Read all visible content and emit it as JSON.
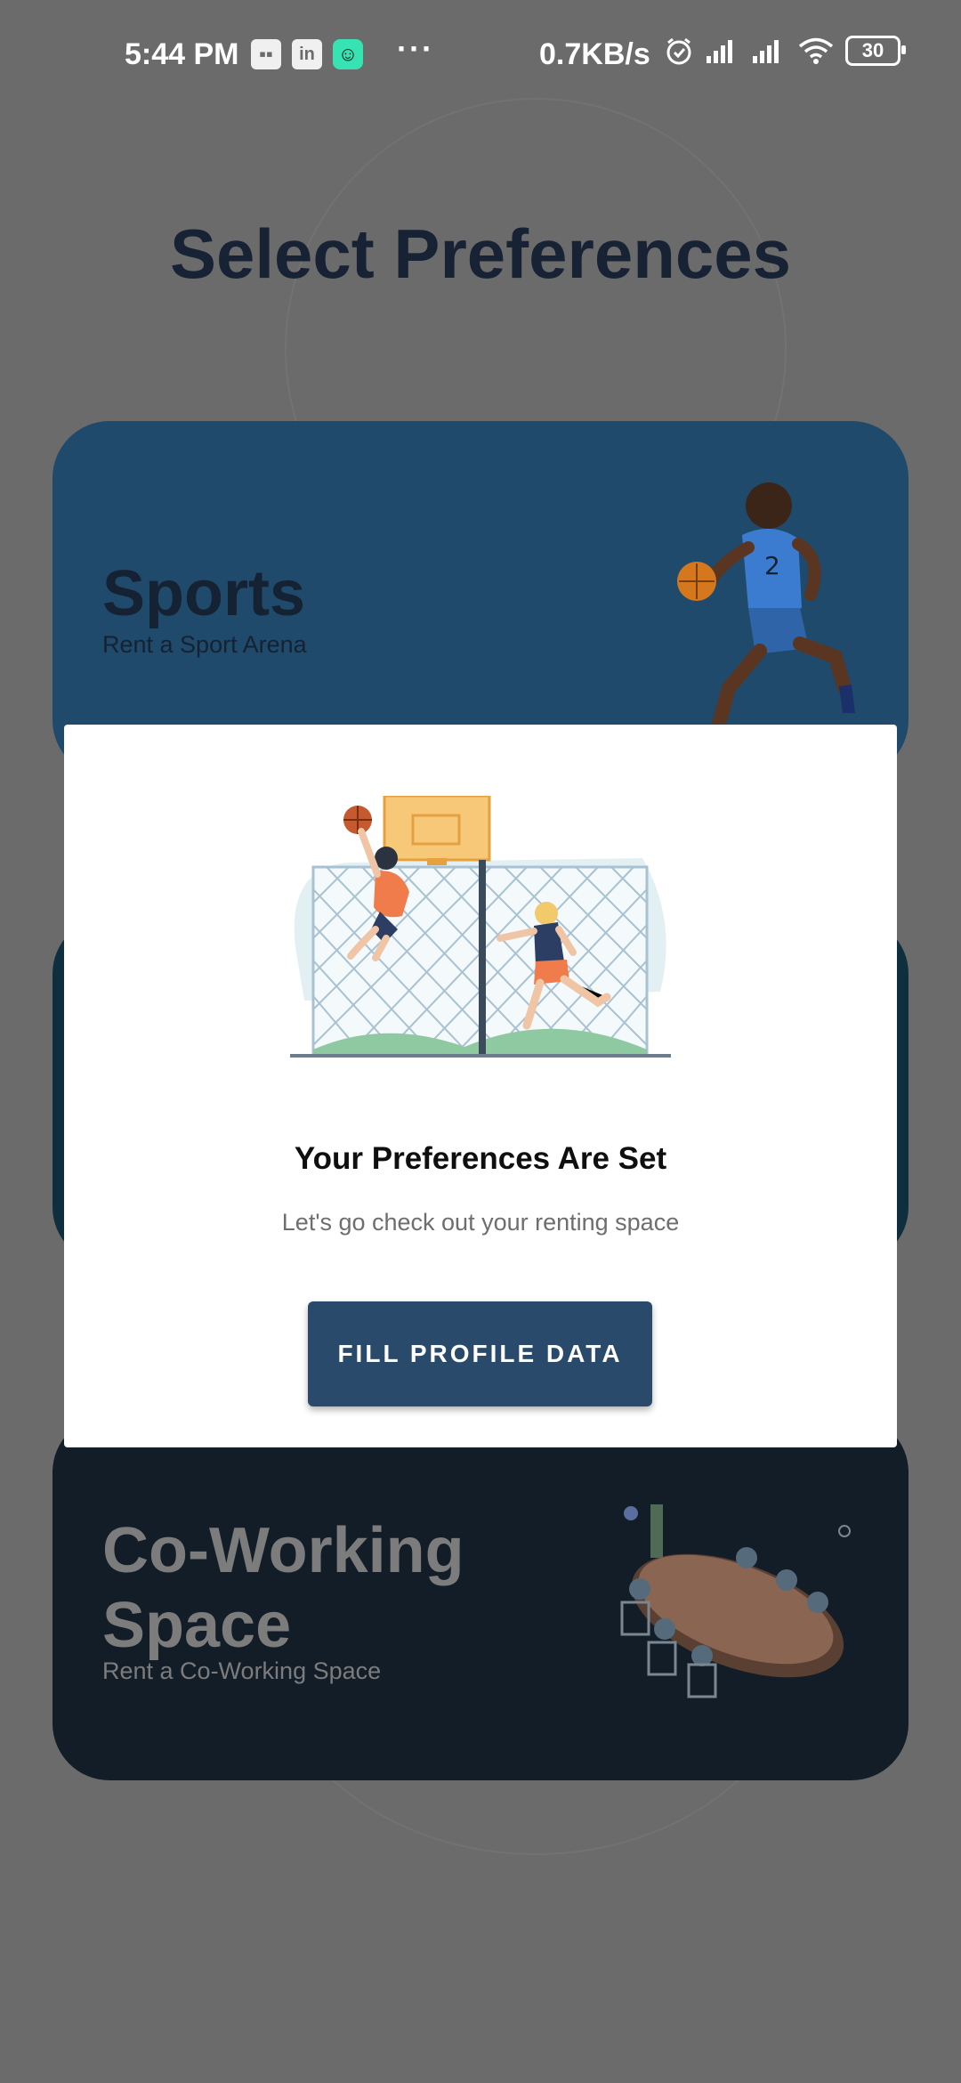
{
  "status_bar": {
    "time": "5:44 PM",
    "network_speed": "0.7KB/s",
    "battery": "30",
    "icons": [
      "message-icon",
      "linkedin-icon",
      "app-icon",
      "more-icon",
      "alarm-icon",
      "signal-icon",
      "signal-icon",
      "wifi-icon",
      "battery-icon"
    ]
  },
  "page": {
    "title": "Select Preferences"
  },
  "cards": {
    "sports": {
      "title": "Sports",
      "subtitle": "Rent a Sport Arena",
      "color": "#204a6b"
    },
    "coworking": {
      "title": "Co-Working Space",
      "subtitle": "Rent a Co-Working Space",
      "color": "#131d28"
    }
  },
  "dialog": {
    "title": "Your Preferences Are Set",
    "message": "Let's go check out your renting space",
    "button_label": "FILL PROFILE DATA",
    "button_color": "#2a4a6b"
  },
  "colors": {
    "scrim_background": "#6b6b6b",
    "title_color": "#172334"
  }
}
